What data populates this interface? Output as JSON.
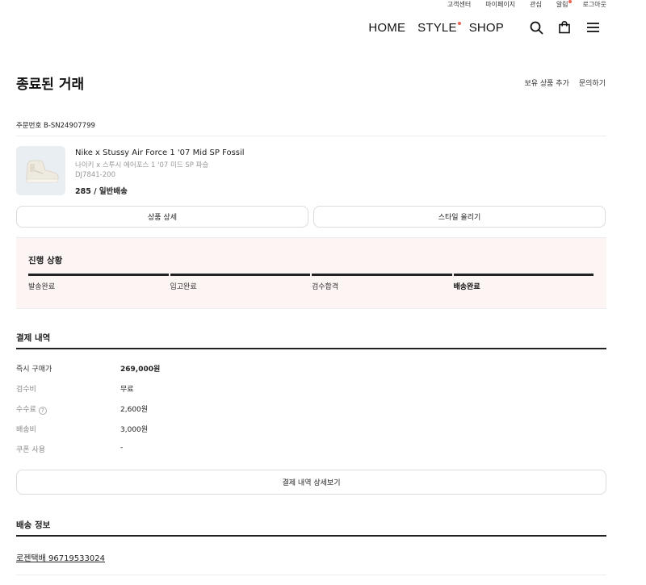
{
  "header": {
    "util_links": [
      "고객센터",
      "마이페이지",
      "관심",
      "알림",
      "로그아웃"
    ],
    "nav": [
      "HOME",
      "STYLE",
      "SHOP"
    ],
    "icons": [
      "search-icon",
      "shopping-bag-icon",
      "menu-icon"
    ],
    "accent_color": "#ef6253"
  },
  "page": {
    "title": "종료된 거래",
    "actions": [
      "보유 상품 추가",
      "문의하기"
    ]
  },
  "order": {
    "order_number": "주문번호 B-SN24907799",
    "product": {
      "name": "Nike x Stussy Air Force 1 '07 Mid SP Fossil",
      "name_ko": "나이키 x 스투시 에어포스 1 '07 미드 SP 파슬",
      "code": "DJ7841-200",
      "option": "285 / 일반배송"
    },
    "buttons": [
      "상품 상세",
      "스타일 올리기"
    ]
  },
  "progress": {
    "title": "진행 상황",
    "steps": [
      "발송완료",
      "입고완료",
      "검수합격",
      "배송완료"
    ],
    "current_step": 4
  },
  "payment": {
    "title": "결제 내역",
    "rows": [
      {
        "label": "즉시 구매가",
        "value": "269,000원"
      },
      {
        "label": "검수비",
        "value": "무료"
      },
      {
        "label": "수수료",
        "value": "2,600원"
      },
      {
        "label": "배송비",
        "value": "3,000원"
      },
      {
        "label": "쿠폰 사용",
        "value": "-"
      }
    ],
    "detail_button": "결제 내역 상세보기"
  },
  "shipping": {
    "title": "배송 정보",
    "tracking": "로젠택배 96719533024"
  }
}
